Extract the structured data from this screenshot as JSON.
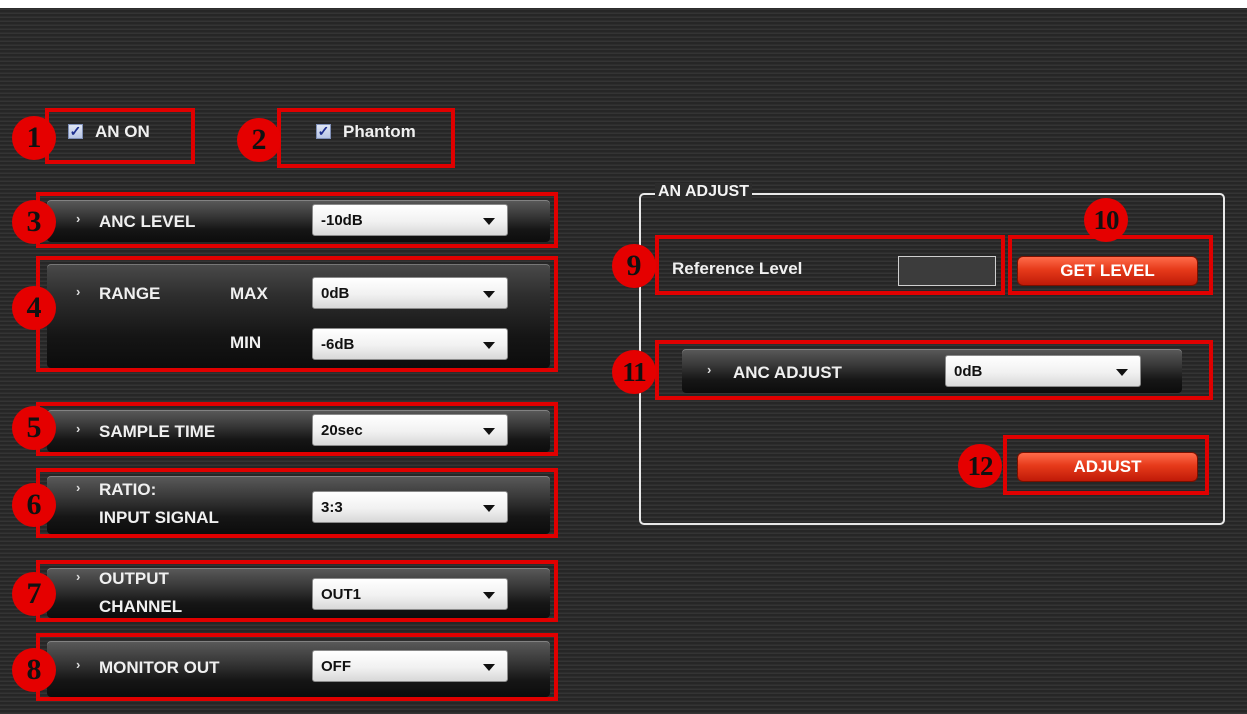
{
  "checkboxes": [
    {
      "badge": "1",
      "label": "AN ON",
      "checked": true
    },
    {
      "badge": "2",
      "label": "Phantom",
      "checked": true
    }
  ],
  "check_glyph": "✓",
  "arrow_glyph": "›",
  "left_rows": {
    "anc_level": {
      "badge": "3",
      "label": "ANC LEVEL",
      "value": "-10dB"
    },
    "range": {
      "badge": "4",
      "label": "RANGE",
      "max_label": "MAX",
      "max_value": "0dB",
      "min_label": "MIN",
      "min_value": "-6dB"
    },
    "sample_time": {
      "badge": "5",
      "label": "SAMPLE TIME",
      "value": "20sec"
    },
    "ratio": {
      "badge": "6",
      "label_line1": "RATIO:",
      "label_line2": "INPUT SIGNAL",
      "value": "3:3"
    },
    "output_channel": {
      "badge": "7",
      "label_line1": "OUTPUT",
      "label_line2": "CHANNEL",
      "value": "OUT1"
    },
    "monitor_out": {
      "badge": "8",
      "label": "MONITOR OUT",
      "value": "OFF"
    }
  },
  "an_adjust": {
    "title": "AN ADJUST",
    "reference": {
      "badge": "9",
      "label": "Reference Level",
      "value": ""
    },
    "get_level": {
      "badge": "10",
      "label": "GET LEVEL"
    },
    "anc_adjust": {
      "badge": "11",
      "label": "ANC ADJUST",
      "value": "0dB"
    },
    "adjust": {
      "badge": "12",
      "label": "ADJUST"
    }
  },
  "colors": {
    "annotation_red": "#e00000",
    "button_red": "#e63a1a",
    "panel_bg": "#2c2c2c"
  }
}
